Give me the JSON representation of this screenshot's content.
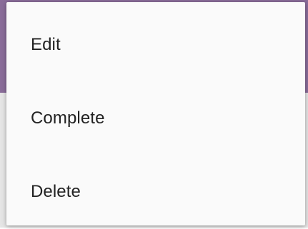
{
  "colors": {
    "app_bar": "#8a6d9a",
    "menu_background": "#fafafa",
    "menu_text": "#222222"
  },
  "menu": {
    "items": [
      {
        "label": "Edit"
      },
      {
        "label": "Complete"
      },
      {
        "label": "Delete"
      }
    ]
  }
}
